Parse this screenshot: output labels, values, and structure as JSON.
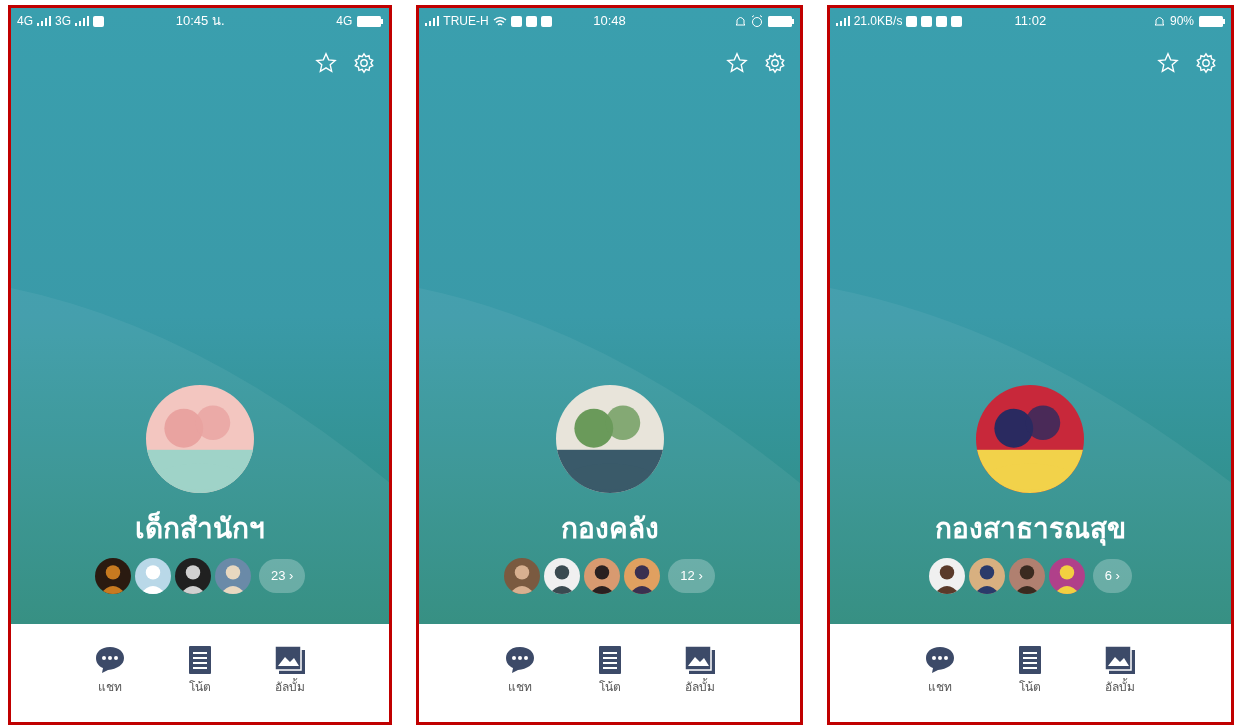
{
  "screens": [
    {
      "status_bar": {
        "left": [
          {
            "kind": "text",
            "text": "4G"
          },
          {
            "kind": "signal"
          },
          {
            "kind": "text",
            "text": "3G"
          },
          {
            "kind": "signal"
          },
          {
            "kind": "app"
          }
        ],
        "time": "10:45 น.",
        "right": [
          {
            "kind": "text",
            "text": "4G"
          },
          {
            "kind": "battery"
          }
        ]
      },
      "group_name": "เด็กสำนักฯ",
      "member_count": "23 ›",
      "nav": [
        {
          "kind": "chat",
          "label": "แชท"
        },
        {
          "kind": "note",
          "label": "โน้ต"
        },
        {
          "kind": "album",
          "label": "อัลบั้ม"
        }
      ]
    },
    {
      "status_bar": {
        "left": [
          {
            "kind": "signal"
          },
          {
            "kind": "text",
            "text": "TRUE-H"
          },
          {
            "kind": "wifi"
          },
          {
            "kind": "app"
          },
          {
            "kind": "app"
          },
          {
            "kind": "app"
          }
        ],
        "time": "10:48",
        "right": [
          {
            "kind": "bell"
          },
          {
            "kind": "alarm"
          },
          {
            "kind": "battery"
          }
        ]
      },
      "group_name": "กองคลัง",
      "member_count": "12 ›",
      "nav": [
        {
          "kind": "chat",
          "label": "แชท"
        },
        {
          "kind": "note",
          "label": "โน้ต"
        },
        {
          "kind": "album",
          "label": "อัลบั้ม"
        }
      ]
    },
    {
      "status_bar": {
        "left": [
          {
            "kind": "signal"
          },
          {
            "kind": "text",
            "text": "21.0KB/s"
          },
          {
            "kind": "app"
          },
          {
            "kind": "app"
          },
          {
            "kind": "app"
          },
          {
            "kind": "app"
          }
        ],
        "time": "11:02",
        "right": [
          {
            "kind": "bell"
          },
          {
            "kind": "text",
            "text": "90%"
          },
          {
            "kind": "battery"
          }
        ]
      },
      "group_name": "กองสาธารณสุข",
      "member_count": "6 ›",
      "nav": [
        {
          "kind": "chat",
          "label": "แชท"
        },
        {
          "kind": "note",
          "label": "โน้ต"
        },
        {
          "kind": "album",
          "label": "อัลบั้ม"
        }
      ]
    }
  ]
}
